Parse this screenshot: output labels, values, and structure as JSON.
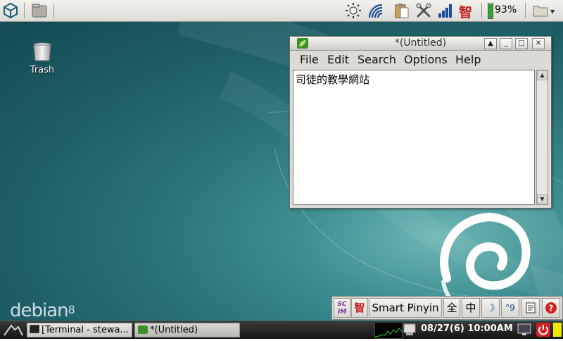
{
  "top_panel": {
    "battery_percent": "93%",
    "battery_level": 0.93,
    "ime_icon_text": "智",
    "icons": [
      "logo-icon",
      "files-icon",
      "brightness-icon",
      "wifi-icon",
      "clipboard-icon",
      "tools-icon",
      "signal-icon",
      "ime-icon",
      "battery-icon",
      "folder-icon"
    ]
  },
  "desktop": {
    "trash_label": "Trash",
    "logo_text": "debian",
    "logo_version": "8"
  },
  "editor": {
    "title": "*(Untitled)",
    "menu": {
      "file": "File",
      "edit": "Edit",
      "search": "Search",
      "options": "Options",
      "help": "Help"
    },
    "text": "司徒的教學網站"
  },
  "ime_bar": {
    "logo_text": "SC IM",
    "kanji": "智",
    "input_method": "Smart Pinyin",
    "full_width": "全",
    "chinese": "中",
    "punct_label": "°9"
  },
  "taskbar": {
    "terminal_task": "[Terminal - stewa...",
    "editor_task": "*(Untitled)",
    "clock": "08/27(6)  10:00AM"
  }
}
